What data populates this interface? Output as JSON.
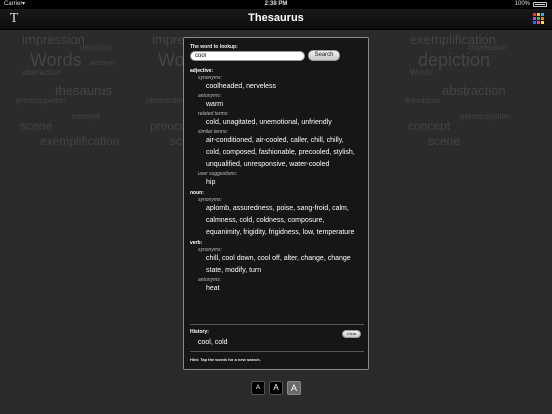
{
  "status_bar": {
    "carrier": "Carrier",
    "time": "2:38 PM",
    "battery": "100%"
  },
  "nav": {
    "title": "Thesaurus",
    "left_icon": "text-font-icon",
    "left_glyph": "T",
    "right_icon": "color-grid-icon",
    "grid_colors": [
      "#e23b3b",
      "#f2c230",
      "#4aa3e8",
      "#9b59d0",
      "#37b34a",
      "#e87c2b",
      "#2f6fd6",
      "#d94aa0",
      "#f5e04a"
    ]
  },
  "background_words": [
    "impression",
    "depiction",
    "Words",
    "antonym",
    "abstraction",
    "thesaurus",
    "preoccupation",
    "concept",
    "scene",
    "exemplification",
    "impression",
    "Words",
    "abstraction",
    "preoccupation",
    "scene",
    "exemplification",
    "impression",
    "depiction",
    "Words",
    "abstraction",
    "thesaurus",
    "preoccupation",
    "concept",
    "scene",
    "exemplification"
  ],
  "lookup": {
    "label": "The word to lookup:",
    "value": "cool",
    "placeholder": "",
    "search_label": "Search"
  },
  "results": [
    {
      "pos": "adjective:",
      "groups": [
        {
          "relation": "synonyms:",
          "words": [
            "coolheaded",
            "nerveless"
          ]
        },
        {
          "relation": "antonyms:",
          "words": [
            "warm"
          ]
        },
        {
          "relation": "related terms:",
          "words": [
            "cold",
            "unagitated",
            "unemotional",
            "unfriendly"
          ]
        },
        {
          "relation": "similar terms:",
          "words": [
            "air-conditioned",
            "air-cooled",
            "caller",
            "chill",
            "chilly",
            "cold",
            "composed",
            "fashionable",
            "precooled",
            "stylish",
            "unqualified",
            "unresponsive",
            "water-cooled"
          ]
        },
        {
          "relation": "user suggestions:",
          "words": [
            "hip"
          ]
        }
      ]
    },
    {
      "pos": "noun:",
      "groups": [
        {
          "relation": "synonyms:",
          "words": [
            "aplomb",
            "assuredness",
            "poise",
            "sang-froid",
            "calm",
            "calmness",
            "cold",
            "coldness",
            "composure",
            "equanimity",
            "frigidity",
            "frigidness",
            "low",
            "temperature"
          ]
        }
      ]
    },
    {
      "pos": "verb:",
      "groups": [
        {
          "relation": "synonyms:",
          "words": [
            "chill",
            "cool down",
            "cool off",
            "alter",
            "change",
            "change state",
            "modify",
            "turn"
          ]
        },
        {
          "relation": "antonyms:",
          "words": [
            "heat"
          ]
        }
      ]
    }
  ],
  "history": {
    "label": "History:",
    "clear_label": "Clear",
    "text": "cool, cold"
  },
  "hint": "Hint: Tap the words for a new search.",
  "font_size_buttons": [
    {
      "label": "A",
      "selected": false
    },
    {
      "label": "A",
      "selected": false
    },
    {
      "label": "A",
      "selected": true
    }
  ]
}
